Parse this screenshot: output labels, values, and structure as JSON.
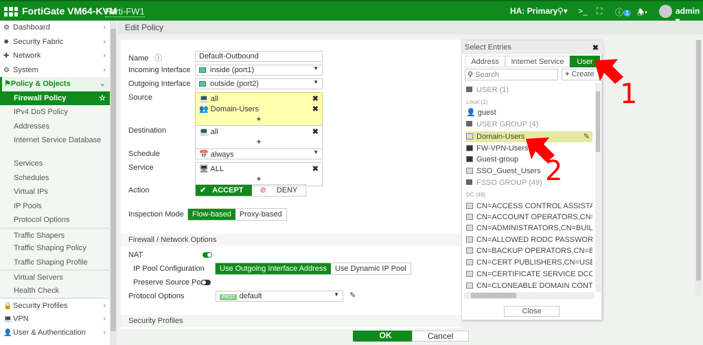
{
  "topbar": {
    "product": "FortiGate VM64-KVM",
    "hostname": "Forti-FW1",
    "ha": "HA: Primary",
    "notification_count": "1",
    "user": "admin"
  },
  "sidebar": {
    "items": [
      {
        "label": "Dashboard",
        "icon": "dashboard-icon",
        "type": "top"
      },
      {
        "label": "Security Fabric",
        "icon": "fabric-icon",
        "type": "top"
      },
      {
        "label": "Network",
        "icon": "network-icon",
        "type": "top"
      },
      {
        "label": "System",
        "icon": "gear-icon",
        "type": "top"
      },
      {
        "label": "Policy & Objects",
        "icon": "policy-icon",
        "type": "open"
      },
      {
        "label": "Firewall Policy",
        "type": "sel"
      },
      {
        "label": "IPv4 DoS Policy",
        "type": "sub"
      },
      {
        "label": "Addresses",
        "type": "sub"
      },
      {
        "label": "Internet Service Database",
        "type": "sub"
      },
      {
        "label": "Services",
        "type": "sub"
      },
      {
        "label": "Schedules",
        "type": "sub"
      },
      {
        "label": "Virtual IPs",
        "type": "sub"
      },
      {
        "label": "IP Pools",
        "type": "sub"
      },
      {
        "label": "Protocol Options",
        "type": "sub"
      },
      {
        "label": "Traffic Shapers",
        "type": "sub"
      },
      {
        "label": "Traffic Shaping Policy",
        "type": "sub"
      },
      {
        "label": "Traffic Shaping Profile",
        "type": "sub"
      },
      {
        "label": "Virtual Servers",
        "type": "sub"
      },
      {
        "label": "Health Check",
        "type": "sub"
      },
      {
        "label": "Security Profiles",
        "icon": "lock-icon",
        "type": "top"
      },
      {
        "label": "VPN",
        "icon": "laptop-icon",
        "type": "top"
      },
      {
        "label": "User & Authentication",
        "icon": "user-icon",
        "type": "top"
      }
    ]
  },
  "page_title": "Edit Policy",
  "form": {
    "name_label": "Name",
    "name_value": "Default-Outbound",
    "incoming_label": "Incoming Interface",
    "incoming_value": "inside (port1)",
    "outgoing_label": "Outgoing Interface",
    "outgoing_value": "outside (port2)",
    "source_label": "Source",
    "source_items": [
      "all",
      "Domain-Users"
    ],
    "destination_label": "Destination",
    "destination_items": [
      "all"
    ],
    "schedule_label": "Schedule",
    "schedule_value": "always",
    "service_label": "Service",
    "service_items": [
      "ALL"
    ],
    "add": "+",
    "action_label": "Action",
    "accept": "ACCEPT",
    "deny": "DENY",
    "inspection_label": "Inspection Mode",
    "flow": "Flow-based",
    "proxy": "Proxy-based",
    "fw_section": "Firewall / Network Options",
    "nat_label": "NAT",
    "nat_enabled": true,
    "ippool_label": "IP Pool Configuration",
    "ippool_outgoing": "Use Outgoing Interface Address",
    "ippool_dynamic": "Use Dynamic IP Pool",
    "preserve_label": "Preserve Source Port",
    "preserve_enabled": false,
    "protocol_label": "Protocol Options",
    "protocol_badge": "PROT",
    "protocol_value": "default",
    "security_section": "Security Profiles"
  },
  "footer": {
    "ok": "OK",
    "cancel": "Cancel"
  },
  "picker": {
    "title": "Select Entries",
    "tabs": [
      "Address",
      "Internet Service",
      "User"
    ],
    "active_tab": "User",
    "search_placeholder": "Search",
    "create": "Create",
    "close": "Close",
    "items": [
      {
        "t": "g",
        "label": "USER (1)"
      },
      {
        "t": "s",
        "label": "Local (1)"
      },
      {
        "t": "u",
        "label": "guest"
      },
      {
        "t": "g",
        "label": "USER GROUP (4)"
      },
      {
        "t": "f",
        "label": "Domain-Users",
        "selected": true
      },
      {
        "t": "l",
        "label": "FW-VPN-Users"
      },
      {
        "t": "l",
        "label": "Guest-group"
      },
      {
        "t": "f",
        "label": "SSO_Guest_Users"
      },
      {
        "t": "g",
        "label": "FSSO GROUP (49)"
      },
      {
        "t": "s",
        "label": "DC (49)"
      },
      {
        "t": "f",
        "label": "CN=ACCESS CONTROL ASSISTANCE"
      },
      {
        "t": "f",
        "label": "CN=ACCOUNT OPERATORS,CN=BU"
      },
      {
        "t": "f",
        "label": "CN=ADMINISTRATORS,CN=BUILTIN"
      },
      {
        "t": "f",
        "label": "CN=ALLOWED RODC PASSWORD R"
      },
      {
        "t": "f",
        "label": "CN=BACKUP OPERATORS,CN=BUILT"
      },
      {
        "t": "f",
        "label": "CN=CERT PUBLISHERS,CN=USERS,D"
      },
      {
        "t": "f",
        "label": "CN=CERTIFICATE SERVICE DCOM A"
      },
      {
        "t": "f",
        "label": "CN=CLONEABLE DOMAIN CONTRO"
      }
    ]
  },
  "annotations": {
    "step1": "1",
    "step2": "2",
    "arrow_color": "#ff0000"
  },
  "colors": {
    "brand_green": "#118a1d",
    "selected_yellow": "#ffffb0"
  }
}
